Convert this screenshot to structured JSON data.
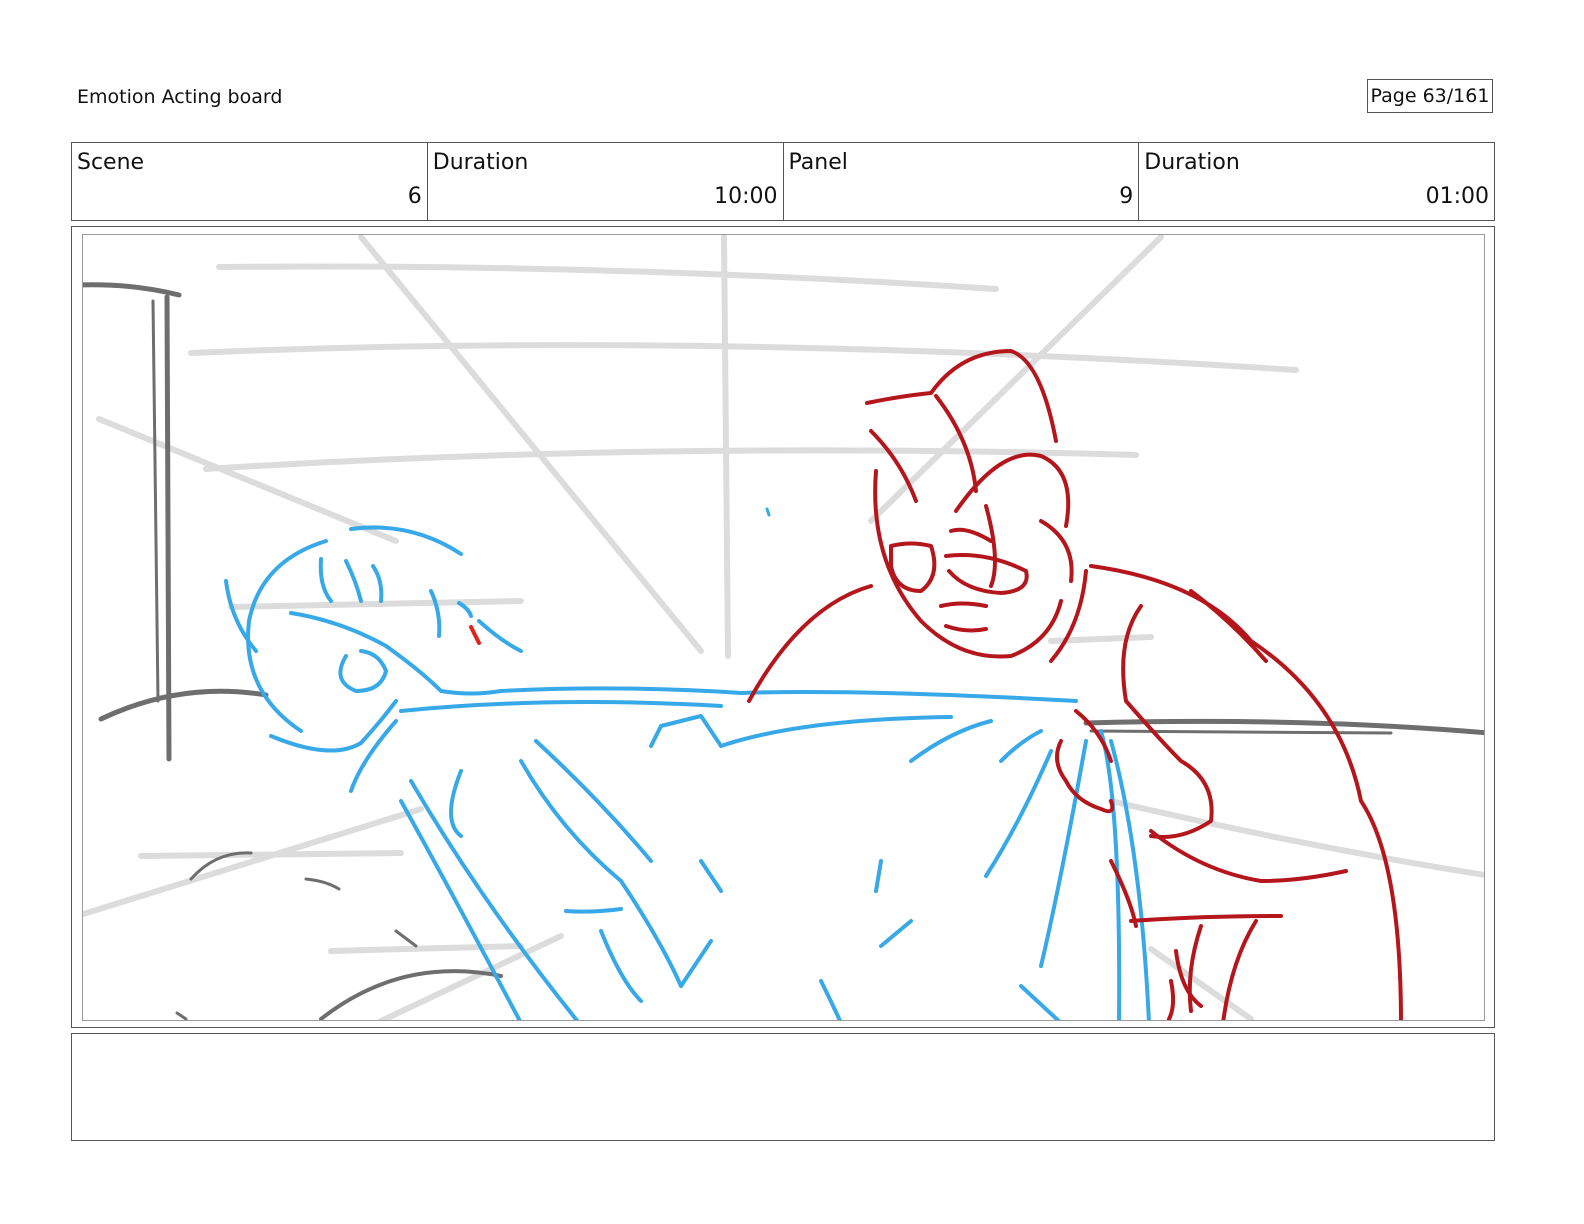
{
  "header": {
    "title": "Emotion Acting board",
    "page_label": "Page",
    "page_number": "63/161"
  },
  "info": {
    "scene_label": "Scene",
    "scene_value": "6",
    "scene_duration_label": "Duration",
    "scene_duration_value": "10:00",
    "panel_label": "Panel",
    "panel_value": "9",
    "panel_duration_label": "Duration",
    "panel_duration_value": "01:00"
  },
  "colors": {
    "guide_lines": "#dcdcdc",
    "dark_strokes": "#6e6e6e",
    "character_left": "#37a8e8",
    "character_right": "#b5161b"
  },
  "notes": {
    "text": ""
  }
}
